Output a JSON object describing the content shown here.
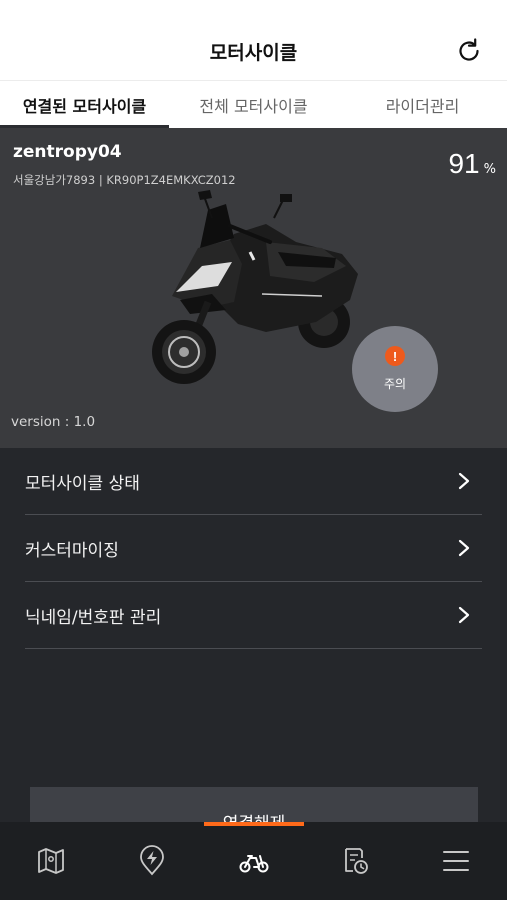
{
  "header": {
    "title": "모터사이클",
    "refresh_icon": "refresh-icon"
  },
  "tabs": [
    {
      "label": "연결된 모터사이클",
      "active": true
    },
    {
      "label": "전체 모터사이클",
      "active": false
    },
    {
      "label": "라이더관리",
      "active": false
    }
  ],
  "vehicle": {
    "nickname": "zentropy04",
    "plate_vin": "서울강남가7893 | KR90P1Z4EMKXCZ012",
    "battery_value": "91",
    "battery_unit": "%",
    "version": "version : 1.0",
    "warning_label": "주의",
    "warning_symbol": "!"
  },
  "menu": [
    {
      "label": "모터사이클 상태"
    },
    {
      "label": "커스터마이징"
    },
    {
      "label": "닉네임/번호판 관리"
    }
  ],
  "disconnect_label": "연결해제",
  "bottom_nav": [
    "map-icon",
    "charging-location-icon",
    "motorcycle-icon",
    "history-icon",
    "menu-icon"
  ],
  "colors": {
    "accent": "#ff6a1a",
    "warning": "#ee5a1c",
    "background": "#25272b",
    "hero": "#3a3b3e"
  }
}
